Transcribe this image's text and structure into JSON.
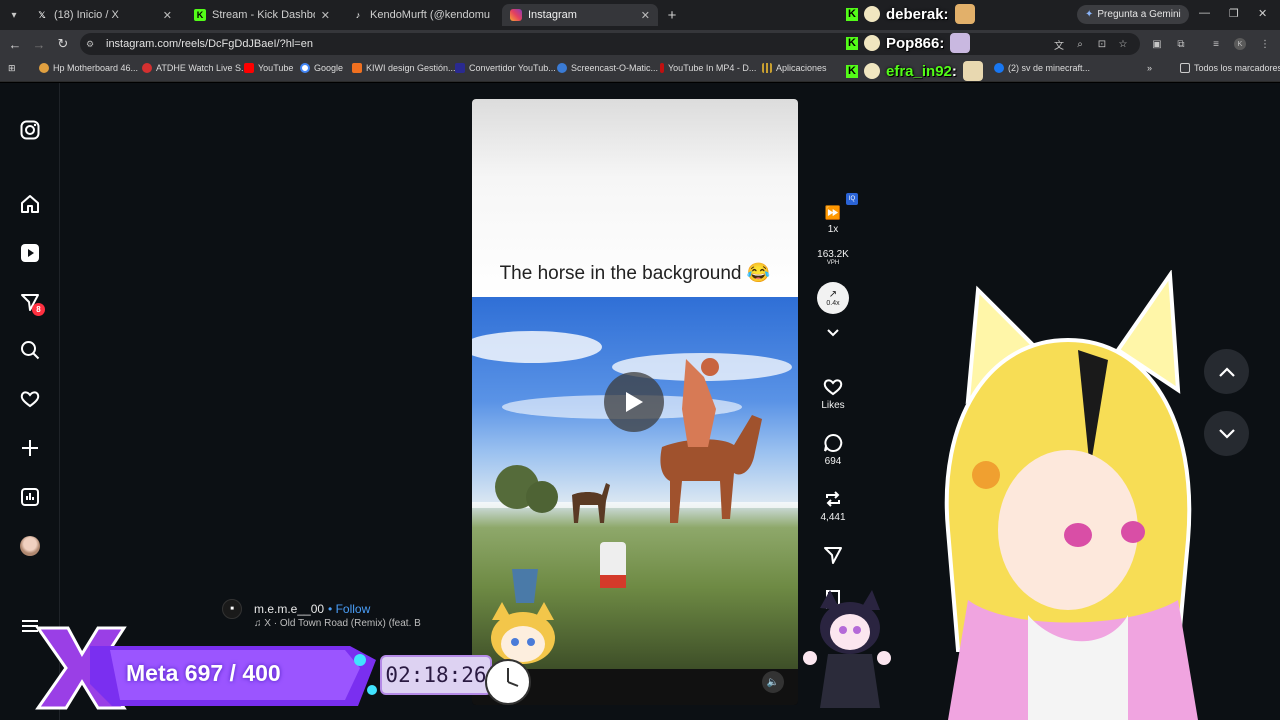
{
  "browser": {
    "tabs": [
      {
        "title": "(18) Inicio / X",
        "icon": "x-logo-icon",
        "active": false
      },
      {
        "title": "Stream - Kick Dashboard",
        "icon": "kick-logo-icon",
        "active": false
      },
      {
        "title": "KendoMurft (@kendomurft) | T",
        "icon": "tiktok-logo-icon",
        "active": false
      },
      {
        "title": "Instagram",
        "icon": "instagram-logo-icon",
        "active": true
      }
    ],
    "gemini_label": "Pregunta a Gemini",
    "url": "instagram.com/reels/DcFgDdJBaeI/?hl=en",
    "bookmarks": [
      {
        "label": "Hp Motherboard 46...",
        "color": "#e0a040"
      },
      {
        "label": "ATDHE Watch Live S...",
        "color": "#d43030"
      },
      {
        "label": "YouTube",
        "color": "#ff0000"
      },
      {
        "label": "Google",
        "color": "#4285f4"
      },
      {
        "label": "KIWI design Gestión...",
        "color": "#f07020"
      },
      {
        "label": "Convertidor YouTub...",
        "color": "#2a2a90"
      },
      {
        "label": "Screencast-O-Matic...",
        "color": "#3a7bd5"
      },
      {
        "label": "YouTube In MP4 - D...",
        "color": "#c01010"
      },
      {
        "label": "Aplicaciones",
        "color": "#8a8a8a"
      },
      {
        "label": "(2) sv de minecraft...",
        "color": "#1877f2"
      }
    ],
    "all_bookmarks_label": "Todos los marcadores"
  },
  "instagram": {
    "notification_count": "8",
    "reel_caption": "The horse in the background 😂",
    "author": "m.e.m.e__00",
    "follow_label": "• Follow",
    "song": "♫  X · Old Town Road (Remix) (feat. B",
    "actions": {
      "speed": "1x",
      "vph_value": "163.2K",
      "vph_label": "VPH",
      "trend_value": "0.4x",
      "likes_label": "Likes",
      "comments": "694",
      "reposts": "4,441"
    }
  },
  "overlay": {
    "chat": [
      {
        "user": "deberak",
        "suffix": " :"
      },
      {
        "user": "Pop866",
        "suffix": " :"
      },
      {
        "user": "efra_in92",
        "suffix": " :"
      }
    ],
    "goal_text": "Meta 697 / 400",
    "timer": "02:18:26"
  },
  "colors": {
    "ig_bg": "#0c1014",
    "kick_green": "#53fc18",
    "follow_blue": "#4a9ef7",
    "notif_red": "#ff3040"
  }
}
